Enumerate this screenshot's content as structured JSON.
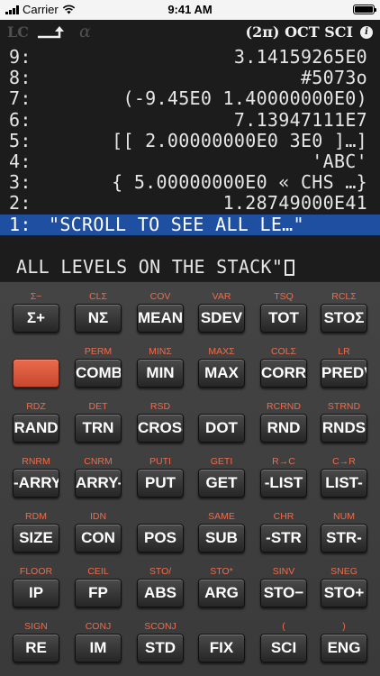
{
  "status_bar": {
    "carrier": "Carrier",
    "time": "9:41 AM"
  },
  "annunciators": {
    "lc": "LC",
    "alpha": "α",
    "modes": "(2π) OCT SCI",
    "info": "i"
  },
  "stack": [
    {
      "level": "9:",
      "value": "3.14159265E0"
    },
    {
      "level": "8:",
      "value": "#5073o"
    },
    {
      "level": "7:",
      "value": "(-9.45E0 1.40000000E0)"
    },
    {
      "level": "6:",
      "value": "7.13947111E7"
    },
    {
      "level": "5:",
      "value": "[[ 2.00000000E0 3E0 ]…]"
    },
    {
      "level": "4:",
      "value": "'ABC'"
    },
    {
      "level": "3:",
      "value": "{ 5.00000000E0 « CHS …}"
    },
    {
      "level": "2:",
      "value": "1.28749000E41"
    },
    {
      "level": "1:",
      "value": "\"SCROLL TO SEE ALL LE…\""
    }
  ],
  "command_line": "ALL LEVELS ON THE STACK\"",
  "colors": {
    "display_bg": "#1c1c1c",
    "selection": "#1f4fa0",
    "shift_label": "#f06c4a",
    "key_bg": "#333333",
    "red_key": "#e05a3c"
  },
  "keys": [
    [
      {
        "shift": "Σ−",
        "label": "Σ+"
      },
      {
        "shift": "CLΣ",
        "label": "NΣ"
      },
      {
        "shift": "COV",
        "label": "MEAN"
      },
      {
        "shift": "VAR",
        "label": "SDEV"
      },
      {
        "shift": "TSQ",
        "label": "TOT"
      },
      {
        "shift": "RCLΣ",
        "label": "STOΣ"
      }
    ],
    [
      {
        "shift": "",
        "label": ""
      },
      {
        "shift": "PERM",
        "label": "COMB"
      },
      {
        "shift": "MINΣ",
        "label": "MIN"
      },
      {
        "shift": "MAXΣ",
        "label": "MAX"
      },
      {
        "shift": "COLΣ",
        "label": "CORR"
      },
      {
        "shift": "LR",
        "label": "PREDV"
      }
    ],
    [
      {
        "shift": "RDZ",
        "label": "RAND"
      },
      {
        "shift": "DET",
        "label": "TRN"
      },
      {
        "shift": "RSD",
        "label": "CROSS"
      },
      {
        "shift": "",
        "label": "DOT"
      },
      {
        "shift": "RCRND",
        "label": "RND"
      },
      {
        "shift": "STRND",
        "label": "RNDS"
      }
    ],
    [
      {
        "shift": "RNRM",
        "label": "-ARRY"
      },
      {
        "shift": "CNRM",
        "label": "ARRY-"
      },
      {
        "shift": "PUTI",
        "label": "PUT"
      },
      {
        "shift": "GETI",
        "label": "GET"
      },
      {
        "shift": "R→C",
        "label": "-LIST"
      },
      {
        "shift": "C→R",
        "label": "LIST-"
      }
    ],
    [
      {
        "shift": "RDM",
        "label": "SIZE"
      },
      {
        "shift": "IDN",
        "label": "CON"
      },
      {
        "shift": "",
        "label": "POS"
      },
      {
        "shift": "SAME",
        "label": "SUB"
      },
      {
        "shift": "CHR",
        "label": "-STR"
      },
      {
        "shift": "NUM",
        "label": "STR-"
      }
    ],
    [
      {
        "shift": "FLOOR",
        "label": "IP"
      },
      {
        "shift": "CEIL",
        "label": "FP"
      },
      {
        "shift": "STO/",
        "label": "ABS"
      },
      {
        "shift": "STO*",
        "label": "ARG"
      },
      {
        "shift": "SINV",
        "label": "STO−"
      },
      {
        "shift": "SNEG",
        "label": "STO+"
      }
    ],
    [
      {
        "shift": "SIGN",
        "label": "RE"
      },
      {
        "shift": "CONJ",
        "label": "IM"
      },
      {
        "shift": "SCONJ",
        "label": "STD"
      },
      {
        "shift": "",
        "label": "FIX"
      },
      {
        "shift": "(",
        "label": "SCI"
      },
      {
        "shift": ")",
        "label": "ENG"
      }
    ]
  ]
}
